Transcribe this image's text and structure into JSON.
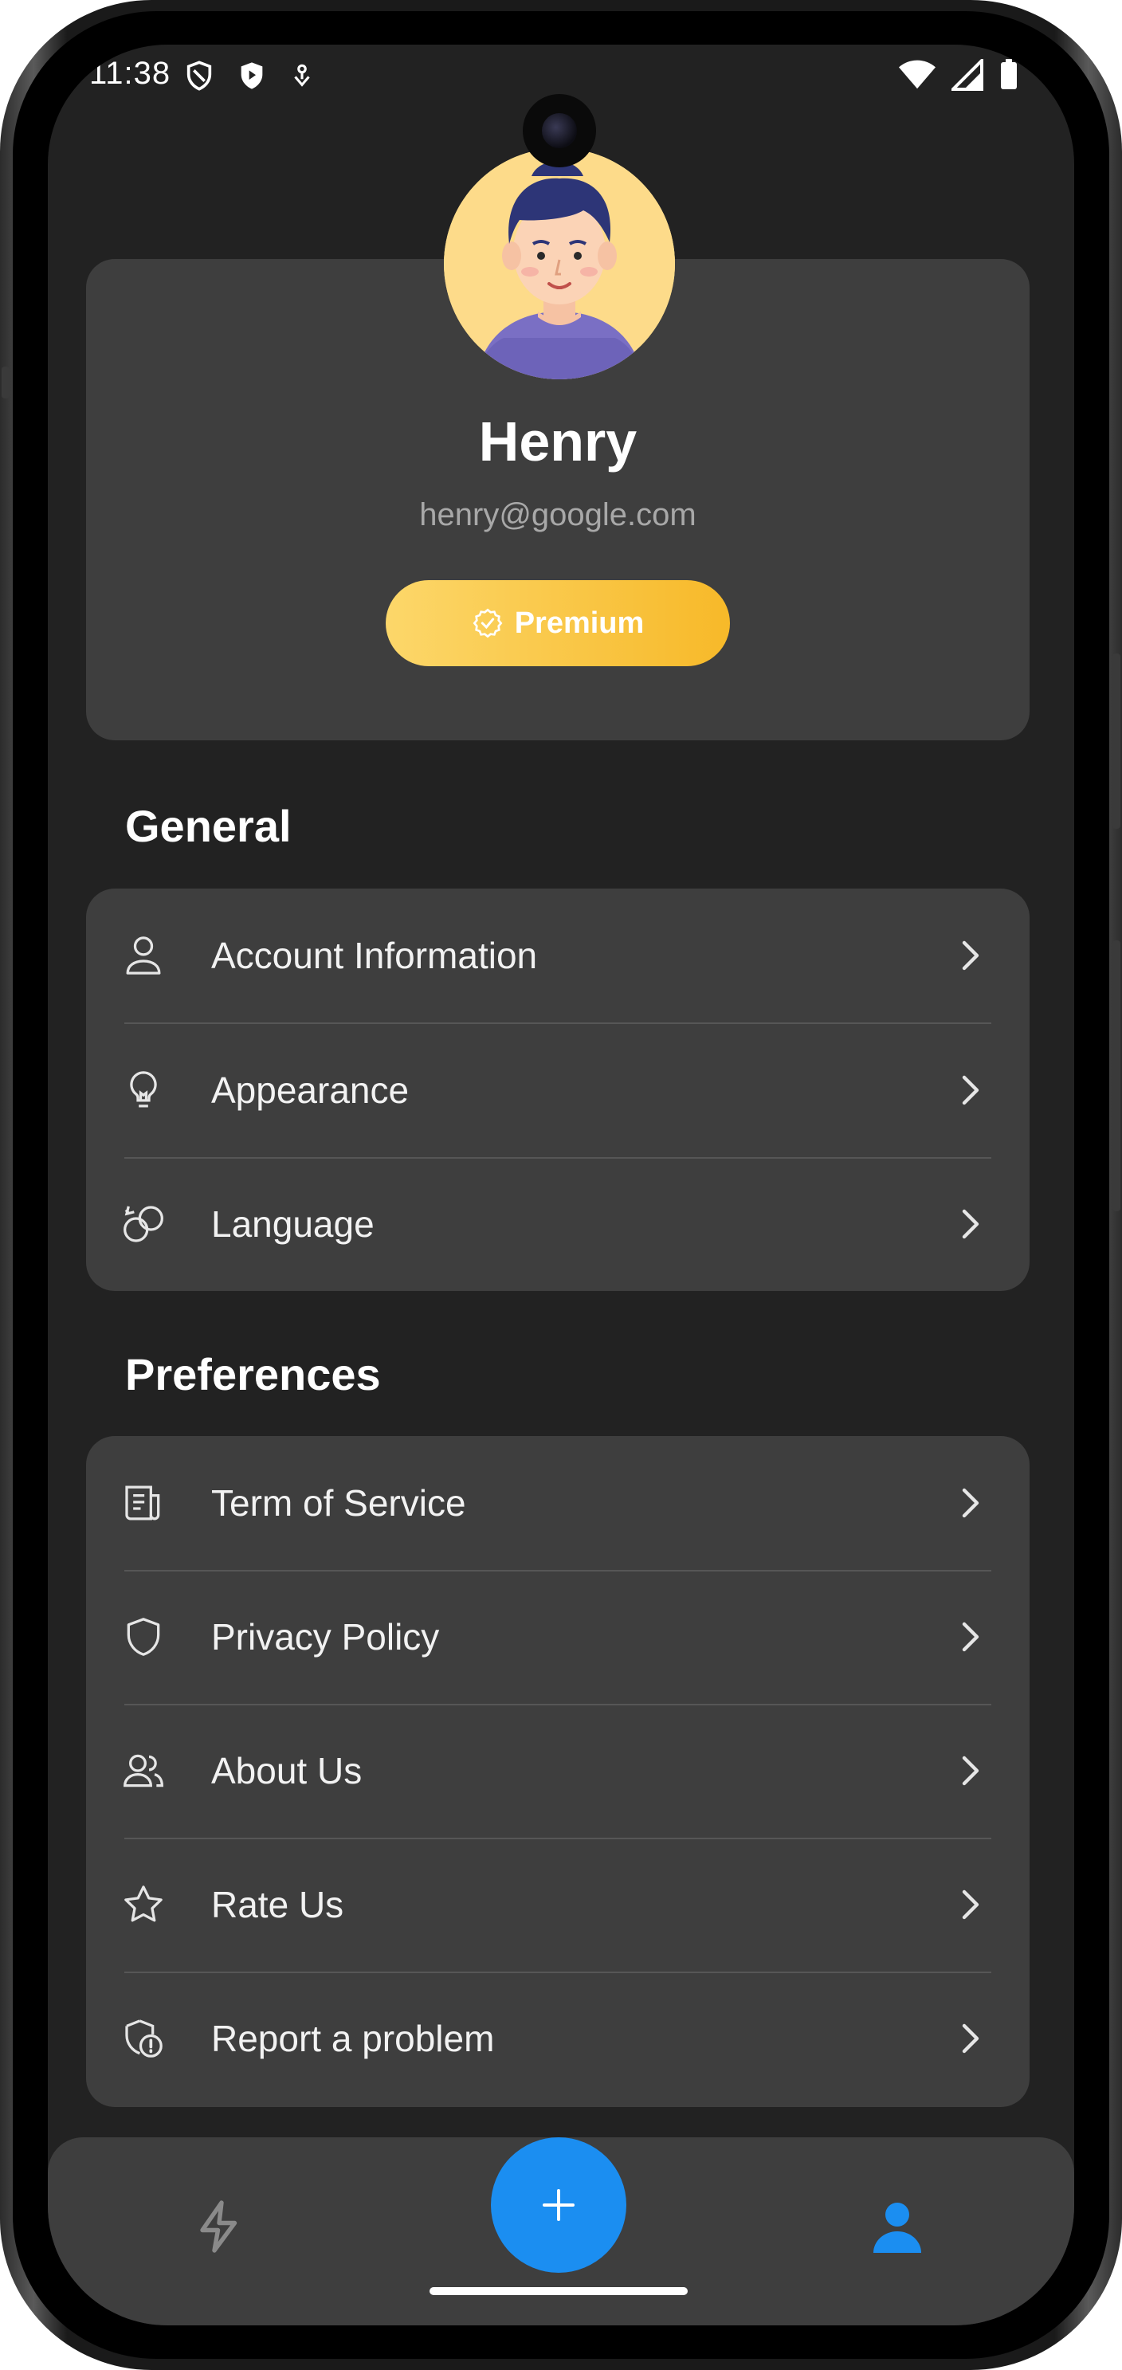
{
  "status_bar": {
    "time": "11:38"
  },
  "profile": {
    "name": "Henry",
    "email": "henry@google.com",
    "premium_label": "Premium"
  },
  "general": {
    "title": "General",
    "items": [
      {
        "label": "Account Information",
        "icon": "user-icon"
      },
      {
        "label": "Appearance",
        "icon": "lightbulb-icon"
      },
      {
        "label": "Language",
        "icon": "language-icon"
      }
    ]
  },
  "preferences": {
    "title": "Preferences",
    "items": [
      {
        "label": "Term of Service",
        "icon": "document-icon"
      },
      {
        "label": "Privacy Policy",
        "icon": "shield-icon"
      },
      {
        "label": "About Us",
        "icon": "users-icon"
      },
      {
        "label": "Rate Us",
        "icon": "star-icon"
      },
      {
        "label": "Report a problem",
        "icon": "report-icon"
      }
    ]
  },
  "bottom_nav": {
    "left": "bolt-icon",
    "center": "plus-icon",
    "right": "profile-icon",
    "active": "profile"
  },
  "colors": {
    "background": "#222222",
    "card": "#3e3e3e",
    "accent": "#1b8ef1",
    "premium": "#f7b929"
  }
}
